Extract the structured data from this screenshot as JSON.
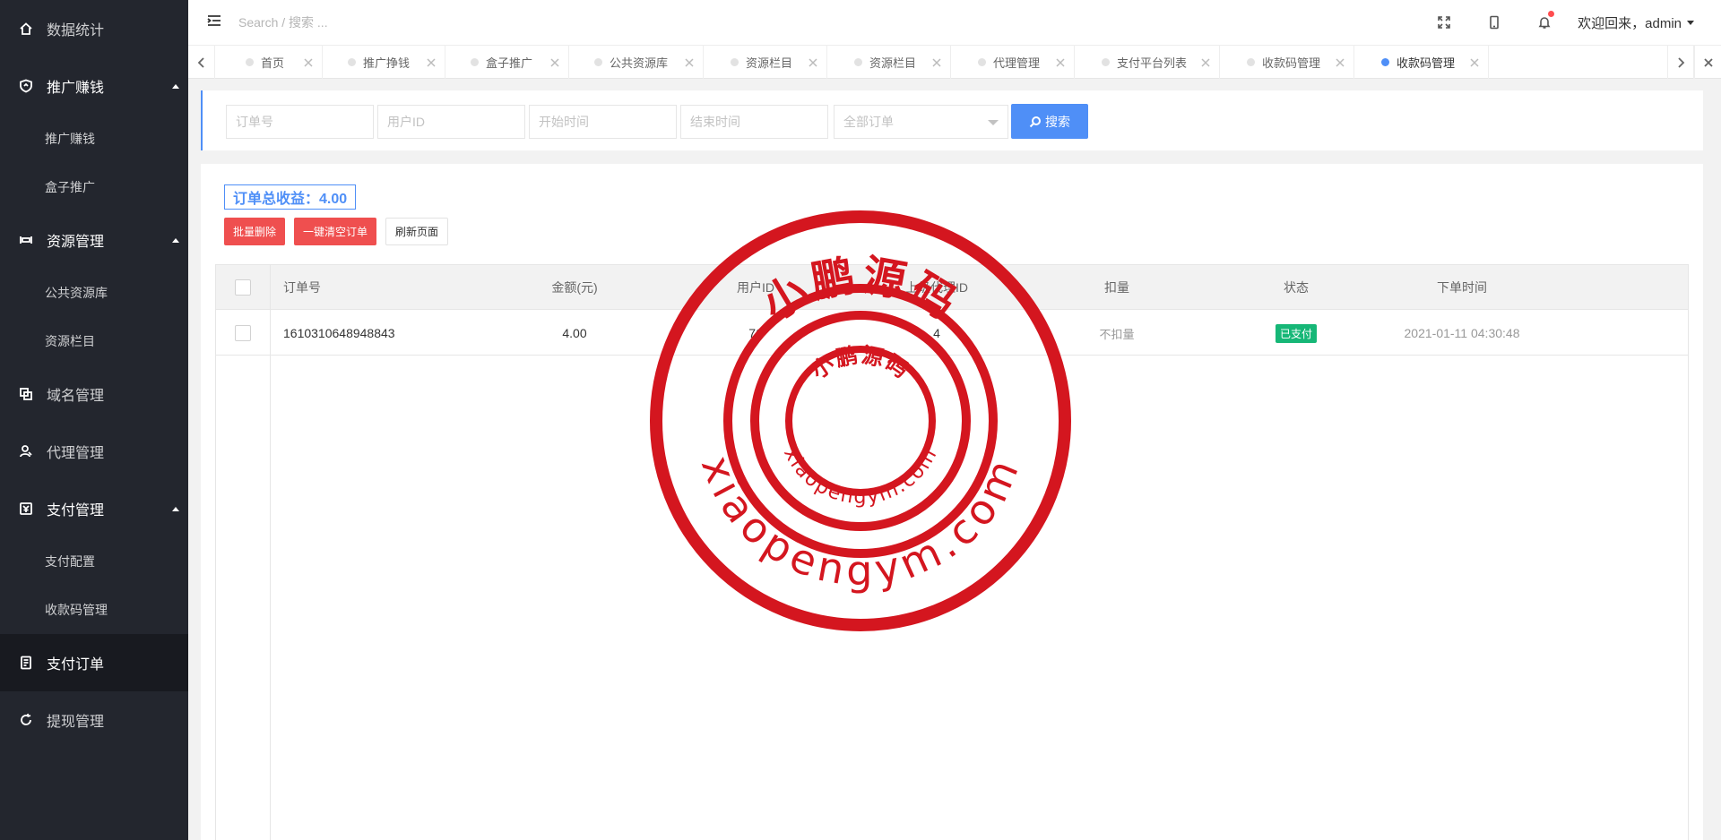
{
  "sidebar": {
    "items": [
      {
        "label": "数据统计",
        "icon": "home-icon"
      },
      {
        "label": "推广赚钱",
        "icon": "shield-icon",
        "expanded": true,
        "children": [
          "推广赚钱",
          "盒子推广"
        ]
      },
      {
        "label": "资源管理",
        "icon": "resource-icon",
        "expanded": true,
        "children": [
          "公共资源库",
          "资源栏目"
        ]
      },
      {
        "label": "域名管理",
        "icon": "domain-icon"
      },
      {
        "label": "代理管理",
        "icon": "agent-icon"
      },
      {
        "label": "支付管理",
        "icon": "payment-icon",
        "expanded": true,
        "children": [
          "支付配置",
          "收款码管理"
        ]
      },
      {
        "label": "支付订单",
        "icon": "order-icon",
        "active": true
      },
      {
        "label": "提现管理",
        "icon": "withdraw-icon"
      }
    ]
  },
  "header": {
    "search_placeholder": "Search / 搜索 ...",
    "welcome": "欢迎回来，admin"
  },
  "tabs": [
    {
      "label": "首页"
    },
    {
      "label": "推广挣钱"
    },
    {
      "label": "盒子推广"
    },
    {
      "label": "公共资源库"
    },
    {
      "label": "资源栏目"
    },
    {
      "label": "资源栏目"
    },
    {
      "label": "代理管理"
    },
    {
      "label": "支付平台列表"
    },
    {
      "label": "收款码管理"
    },
    {
      "label": "收款码管理",
      "active": true
    }
  ],
  "filters": {
    "order_no_placeholder": "订单号",
    "user_id_placeholder": "用户ID",
    "start_time_placeholder": "开始时间",
    "end_time_placeholder": "结束时间",
    "order_type_selected": "全部订单",
    "search_label": "搜索"
  },
  "summary": {
    "total_label": "订单总收益：4.00"
  },
  "actions": {
    "batch_delete": "批量删除",
    "clear_orders": "一键清空订单",
    "refresh": "刷新页面"
  },
  "table": {
    "columns": [
      "订单号",
      "金额(元)",
      "用户ID",
      "上级代理ID",
      "扣量",
      "状态",
      "下单时间"
    ],
    "rows": [
      {
        "order_no": "1610310648948843",
        "amount": "4.00",
        "user_id": "76",
        "parent_agent_id": "4",
        "deduct": "不扣量",
        "status": "已支付",
        "time": "2021-01-11 04:30:48"
      }
    ]
  },
  "watermark": {
    "name": "小鹏源码",
    "domain": "xiaopengym.com",
    "color": "#d4161f"
  },
  "colors": {
    "sidebar_bg": "#23262e",
    "accent": "#4f8ff7",
    "danger": "#ef4f4f",
    "success": "#16b777"
  }
}
